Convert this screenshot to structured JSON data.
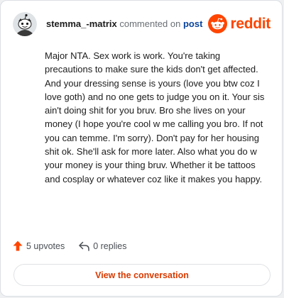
{
  "comment": {
    "username": "stemma_-matrix",
    "action_text": "commented on",
    "post_link": "post",
    "body": "Major NTA. Sex work is work. You're taking precautions to make sure the kids don't get affected. And your dressing sense is yours (love you btw coz I love goth) and no one gets to judge you on it. Your sis ain't doing shit for you bruv. Bro she lives on your money (I hope you're cool w me calling you bro. If not you can temme. I'm sorry). Don't pay for her housing shit ok. She'll ask for more later. Also what you do w your money is your thing bruv. Whether it be tattoos and cosplay or whatever coz like it makes you happy."
  },
  "brand": {
    "logo_text": "reddit",
    "logo_icon": "reddit-snoo-icon",
    "accent_color": "#ff4500"
  },
  "stats": {
    "upvotes_label": "5 upvotes",
    "upvote_icon": "upvote-arrow-icon",
    "upvote_color": "#ff4500",
    "replies_label": "0 replies",
    "reply_icon": "reply-arrow-icon"
  },
  "actions": {
    "view_conversation_label": "View the conversation",
    "link_color": "#d93a00"
  }
}
